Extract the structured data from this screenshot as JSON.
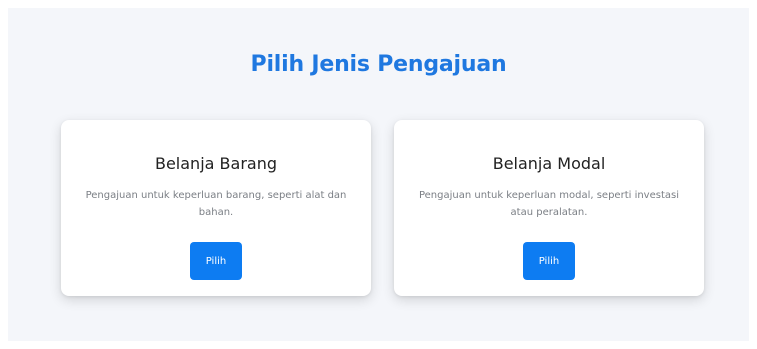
{
  "page": {
    "title": "Pilih Jenis Pengajuan"
  },
  "options": [
    {
      "title": "Belanja Barang",
      "description": "Pengajuan untuk keperluan barang, seperti alat dan bahan.",
      "button_label": "Pilih"
    },
    {
      "title": "Belanja Modal",
      "description": "Pengajuan untuk keperluan modal, seperti investasi atau peralatan.",
      "button_label": "Pilih"
    }
  ],
  "colors": {
    "accent": "#1f78e0",
    "button": "#0d7cf2",
    "background": "#f4f6fa"
  }
}
